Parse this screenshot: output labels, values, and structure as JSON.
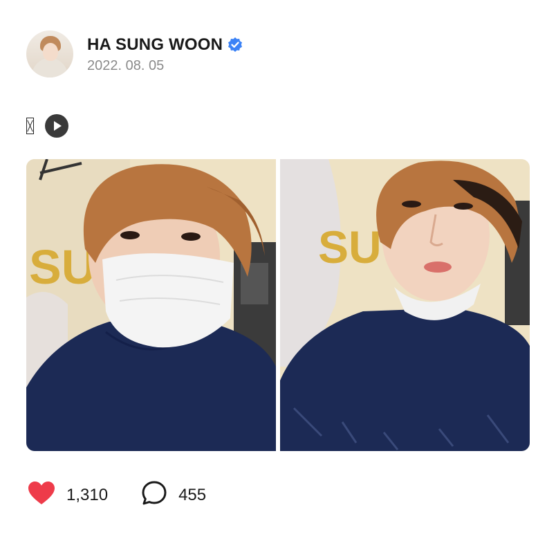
{
  "author": {
    "name": "HA SUNG WOON",
    "verified_icon": "verified-badge-icon",
    "date": "2022. 08. 05",
    "avatar_icon": "profile-photo"
  },
  "post": {
    "text_glyph": "missing-glyph-box",
    "media_icon": "play-icon",
    "photos": [
      {
        "name": "masked-selfie-photo"
      },
      {
        "name": "unmasked-selfie-photo"
      }
    ],
    "photo_text": "SU"
  },
  "stats": {
    "likes": "1,310",
    "comments": "455",
    "like_icon": "heart-icon",
    "comment_icon": "comment-bubble-icon"
  },
  "colors": {
    "heart": "#ee3b4a",
    "verified": "#3b82f6",
    "shirt": "#1c2a55",
    "hair": "#b8753f",
    "wall": "#efe3c7",
    "gold_text": "#d8ad3c"
  }
}
